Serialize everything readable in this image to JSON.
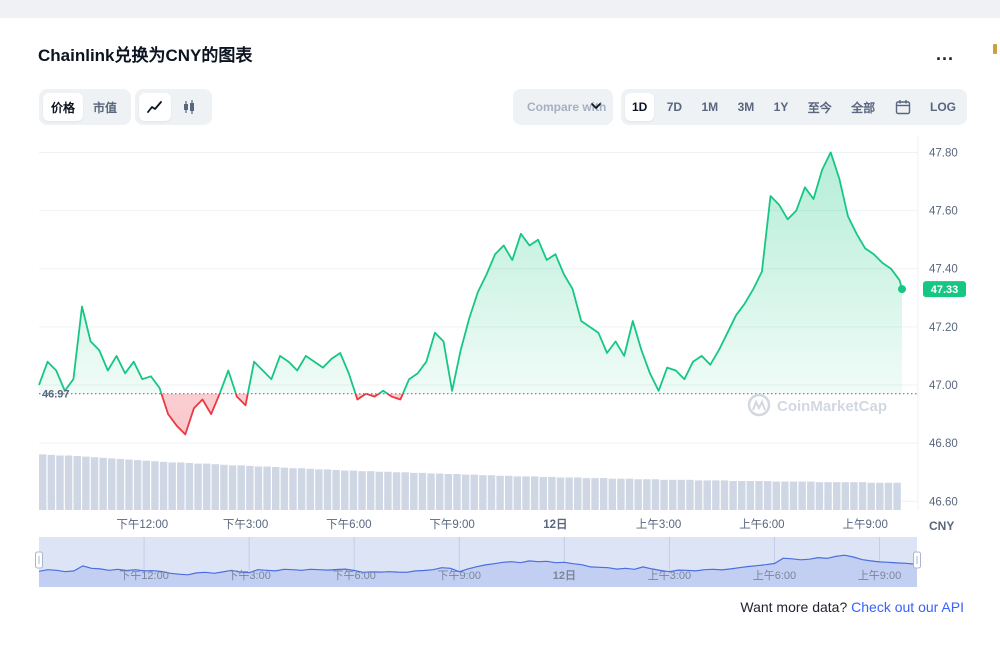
{
  "page": {
    "title": "Chainlink兑换为CNY的图表",
    "more_label": "...",
    "footer_text": "Want more data?",
    "footer_link": "Check out our API"
  },
  "toolbar": {
    "type_options": [
      "价格",
      "市值"
    ],
    "type_active": "价格",
    "chart_styles": [
      "line-chart-icon",
      "candlestick-icon"
    ],
    "compare_label": "Compare with",
    "ranges": [
      "1D",
      "7D",
      "1M",
      "3M",
      "1Y",
      "至今",
      "全部"
    ],
    "range_active": "1D",
    "calendar_icon": "calendar-icon",
    "log_label": "LOG"
  },
  "colors": {
    "up": "#16c784",
    "down": "#ea3943",
    "volume": "#cfd6e4",
    "navigator": "#4a6ee0"
  },
  "chart_data": {
    "type": "area",
    "title": "Chainlink兑换为CNY的图表",
    "ylabel": "CNY",
    "ylim": [
      46.57,
      47.86
    ],
    "yticks": [
      47.8,
      47.6,
      47.4,
      47.2,
      47.0,
      46.8,
      46.6
    ],
    "ytick_labels": [
      "47.80",
      "47.60",
      "47.40",
      "47.20",
      "47.00",
      "46.80",
      "46.60"
    ],
    "x_range": [
      9.0,
      34.07
    ],
    "xticks": [
      {
        "x": 12,
        "label": "下午12:00"
      },
      {
        "x": 15,
        "label": "下午3:00"
      },
      {
        "x": 18,
        "label": "下午6:00"
      },
      {
        "x": 21,
        "label": "下午9:00"
      },
      {
        "x": 24,
        "label": "12日"
      },
      {
        "x": 27,
        "label": "上午3:00"
      },
      {
        "x": 30,
        "label": "上午6:00"
      },
      {
        "x": 33,
        "label": "上午9:00"
      }
    ],
    "open_price": 46.97,
    "open_price_label": "46.97",
    "current_price": 47.33,
    "current_price_label": "47.33",
    "grid": true,
    "watermark": "CoinMarketCap",
    "series": [
      {
        "x": [
          9.0,
          9.25,
          9.5,
          9.75,
          10.0,
          10.25,
          10.5,
          10.75,
          11.0,
          11.25,
          11.5,
          11.75,
          12.0,
          12.25,
          12.5,
          12.75,
          13.0,
          13.25,
          13.5,
          13.75,
          14.0,
          14.25,
          14.5,
          14.75,
          15.0,
          15.25,
          15.5,
          15.75,
          16.0,
          16.25,
          16.5,
          16.75,
          17.0,
          17.25,
          17.5,
          17.75,
          18.0,
          18.25,
          18.5,
          18.75,
          19.0,
          19.25,
          19.5,
          19.75,
          20.0,
          20.25,
          20.5,
          20.75,
          21.0,
          21.25,
          21.5,
          21.75,
          22.0,
          22.25,
          22.5,
          22.75,
          23.0,
          23.25,
          23.5,
          23.75,
          24.0,
          24.25,
          24.5,
          24.75,
          25.0,
          25.25,
          25.5,
          25.75,
          26.0,
          26.25,
          26.5,
          26.75,
          27.0,
          27.25,
          27.5,
          27.75,
          28.0,
          28.25,
          28.5,
          28.75,
          29.0,
          29.25,
          29.5,
          29.75,
          30.0,
          30.25,
          30.5,
          30.75,
          31.0,
          31.25,
          31.5,
          31.75,
          32.0,
          32.25,
          32.5,
          32.75,
          33.0,
          33.25,
          33.5,
          33.75,
          34.0,
          34.07
        ],
        "y": [
          47.0,
          47.08,
          47.05,
          46.98,
          47.02,
          47.27,
          47.15,
          47.12,
          47.05,
          47.1,
          47.04,
          47.08,
          47.02,
          47.03,
          46.99,
          46.9,
          46.86,
          46.83,
          46.92,
          46.95,
          46.9,
          46.97,
          47.05,
          46.96,
          46.93,
          47.08,
          47.05,
          47.02,
          47.1,
          47.08,
          47.05,
          47.1,
          47.08,
          47.06,
          47.09,
          47.11,
          47.04,
          46.95,
          46.97,
          46.96,
          46.98,
          46.96,
          46.95,
          47.02,
          47.04,
          47.08,
          47.18,
          47.15,
          46.98,
          47.12,
          47.23,
          47.32,
          47.38,
          47.45,
          47.48,
          47.43,
          47.52,
          47.48,
          47.5,
          47.43,
          47.45,
          47.38,
          47.33,
          47.22,
          47.2,
          47.18,
          47.11,
          47.15,
          47.1,
          47.22,
          47.12,
          47.04,
          46.98,
          47.06,
          47.05,
          47.02,
          47.08,
          47.1,
          47.07,
          47.12,
          47.18,
          47.24,
          47.28,
          47.33,
          47.39,
          47.65,
          47.62,
          47.57,
          47.6,
          47.68,
          47.64,
          47.74,
          47.8,
          47.71,
          47.58,
          47.52,
          47.47,
          47.45,
          47.42,
          47.4,
          47.36,
          47.33
        ]
      }
    ],
    "volume": {
      "values": [
        0.96,
        0.95,
        0.94,
        0.94,
        0.93,
        0.92,
        0.91,
        0.9,
        0.89,
        0.88,
        0.87,
        0.86,
        0.85,
        0.84,
        0.83,
        0.82,
        0.82,
        0.81,
        0.8,
        0.8,
        0.79,
        0.78,
        0.77,
        0.77,
        0.76,
        0.75,
        0.75,
        0.74,
        0.73,
        0.72,
        0.72,
        0.71,
        0.7,
        0.7,
        0.69,
        0.68,
        0.68,
        0.67,
        0.67,
        0.66,
        0.66,
        0.65,
        0.65,
        0.64,
        0.64,
        0.63,
        0.63,
        0.62,
        0.62,
        0.61,
        0.61,
        0.6,
        0.6,
        0.59,
        0.59,
        0.58,
        0.58,
        0.58,
        0.57,
        0.57,
        0.56,
        0.56,
        0.56,
        0.55,
        0.55,
        0.55,
        0.54,
        0.54,
        0.54,
        0.53,
        0.53,
        0.53,
        0.52,
        0.52,
        0.52,
        0.52,
        0.51,
        0.51,
        0.51,
        0.51,
        0.5,
        0.5,
        0.5,
        0.5,
        0.5,
        0.49,
        0.49,
        0.49,
        0.49,
        0.49,
        0.48,
        0.48,
        0.48,
        0.48,
        0.48,
        0.48,
        0.47,
        0.47,
        0.47,
        0.47
      ]
    }
  }
}
